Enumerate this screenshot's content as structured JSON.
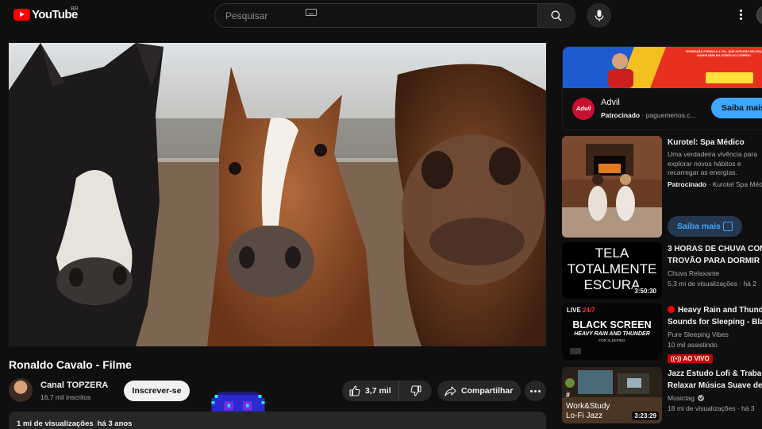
{
  "header": {
    "logo_text": "YouTube",
    "country_code": "BR",
    "search_placeholder": "Pesquisar"
  },
  "video": {
    "title": "Ronaldo Cavalo - Filme",
    "channel_name": "Canal TOPZERA",
    "subscribers": "16,7 mil inscritos",
    "subscribe_label": "Inscrever-se",
    "like_count": "3,7 mil",
    "share_label": "Compartilhar",
    "views": "1 mi de visualizações",
    "age": "há 3 anos"
  },
  "ad": {
    "banner_text": "PROMOÇÃO FÓRMULA 1 VOL. QUE ACELERA SEU DIA. GANHE R$50 NO GORRO DO CORREIO",
    "brand_logo": "Advil",
    "name": "Advil",
    "sponsored_label": "Patrocinado",
    "domain": "paguemenos.c...",
    "cta": "Saiba mais"
  },
  "sidebar": {
    "items": [
      {
        "title": "Kurotel: Spa Médico",
        "description": "Uma verdadeira vivência para explorar novos hábitos e recarregar as energias.",
        "sponsored_label": "Patrocinado",
        "channel": "Kurotel Spa Médico",
        "cta": "Saiba mais"
      },
      {
        "title_line1": "3 HORAS DE CHUVA COM",
        "title_line2": "TROVÃO PARA DORMIR E",
        "channel": "Chuva Relaxante",
        "stats": "5,3 mi de visualizações",
        "age": "há 2",
        "thumb_text": [
          "TELA",
          "TOTALMENTE",
          "ESCURA"
        ],
        "duration": "3:50:30"
      },
      {
        "title_line1": "Heavy Rain and Thunder",
        "title_line2": "Sounds for Sleeping - Bla",
        "channel": "Pure Sleeping Vibes",
        "stats": "10 mil assistindo",
        "live_badge": "AO VIVO",
        "thumb_live": "LIVE",
        "thumb_hours": "24/7",
        "thumb_title": "BLACK SCREEN",
        "thumb_sub": "HEAVY RAIN AND THUNDER",
        "thumb_sub2": "FOR SLEEPING"
      },
      {
        "title_line1": "Jazz Estudo Lofi & Trabal",
        "title_line2": "Relaxar Música Suave de",
        "channel": "Musictag",
        "stats": "18 mi de visualizações",
        "age": "há 3",
        "thumb_hash": "#",
        "thumb_line1": "Work&Study",
        "thumb_line2": "Lo-Fi Jazz",
        "duration": "3:23:29"
      }
    ]
  },
  "colors": {
    "background": "#0f0f0f",
    "surface": "#272727",
    "brand_red": "#ff0000",
    "link_blue": "#3ea6ff",
    "live_red": "#cc0000"
  },
  "icons": [
    "youtube-logo-icon",
    "keyboard-icon",
    "search-icon",
    "mic-icon",
    "more-vert-icon",
    "like-icon",
    "dislike-icon",
    "share-icon",
    "external-link-icon",
    "live-dot-icon",
    "verified-check-icon"
  ]
}
